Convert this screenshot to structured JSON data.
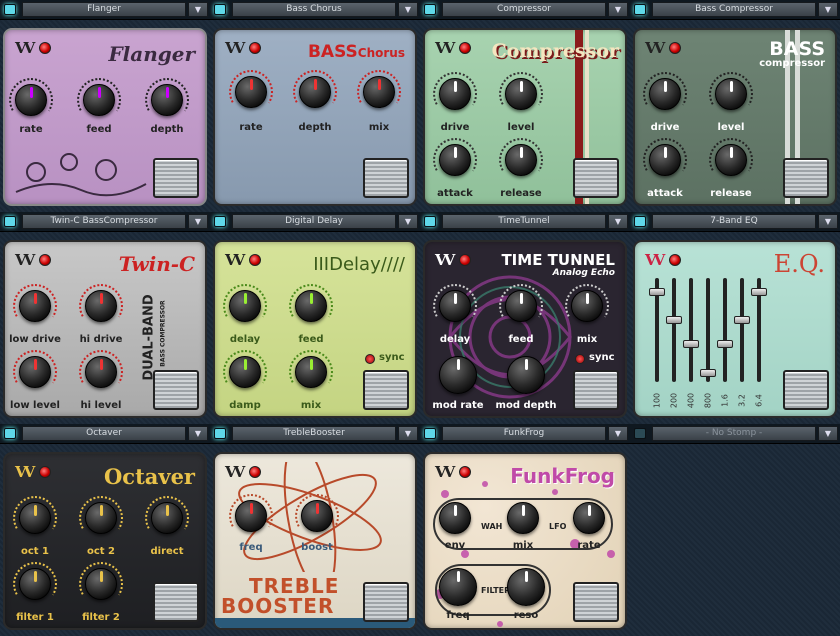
{
  "slots": [
    {
      "preset": "Flanger",
      "title": "Flanger",
      "knobs": [
        "rate",
        "feed",
        "depth"
      ]
    },
    {
      "preset": "Bass Chorus",
      "title_a": "BASS",
      "title_b": "Chorus",
      "knobs": [
        "rate",
        "depth",
        "mix"
      ]
    },
    {
      "preset": "Compressor",
      "title": "Compressor",
      "knobs": [
        "drive",
        "level",
        "attack",
        "release"
      ]
    },
    {
      "preset": "Bass Compressor",
      "title_a": "BASS",
      "title_b": "compressor",
      "knobs": [
        "drive",
        "level",
        "attack",
        "release"
      ]
    },
    {
      "preset": "Twin-C BassCompressor",
      "title": "Twin-C",
      "subtitle_a": "DUAL-BAND",
      "subtitle_b": "BASS COMPRESSOR",
      "knobs": [
        "low drive",
        "hi drive",
        "low level",
        "hi level"
      ]
    },
    {
      "preset": "Digital Delay",
      "title": "IIIDelay////",
      "sync": "sync",
      "knobs": [
        "delay",
        "feed",
        "damp",
        "mix"
      ]
    },
    {
      "preset": "TimeTunnel",
      "title": "TIME TUNNEL",
      "subtitle": "Analog Echo",
      "sync": "sync",
      "knobs": [
        "delay",
        "feed",
        "mix",
        "mod rate",
        "mod depth"
      ]
    },
    {
      "preset": "7-Band EQ",
      "title": "E.Q.",
      "bands": [
        "100",
        "200",
        "400",
        "800",
        "1.6",
        "3.2",
        "6.4"
      ],
      "band_levels": [
        0.9,
        0.6,
        0.35,
        0.05,
        0.35,
        0.6,
        0.9
      ]
    },
    {
      "preset": "Octaver",
      "title": "Octaver",
      "knobs": [
        "oct 1",
        "oct 2",
        "direct",
        "filter 1",
        "filter 2"
      ]
    },
    {
      "preset": "TrebleBooster",
      "title_a": "TREBLE",
      "title_b": "BOOSTER",
      "knobs": [
        "freq",
        "boost"
      ]
    },
    {
      "preset": "FunkFrog",
      "title": "FunkFrog",
      "wah": "WAH",
      "lfo": "LFO",
      "filter": "FILTER",
      "knobs": [
        "env",
        "mix",
        "rate",
        "freq",
        "reso"
      ]
    },
    {
      "preset": "- No Stomp -"
    }
  ],
  "colors": {
    "accent": "#5fd8e8",
    "led_red": "#cc0000"
  }
}
